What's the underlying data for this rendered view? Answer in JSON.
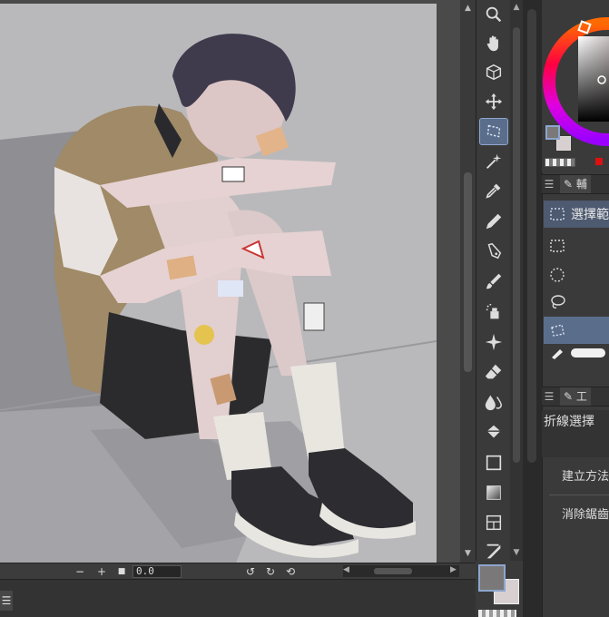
{
  "canvas": {
    "zoom_value": "0.0"
  },
  "status_bar": {
    "zoom_out_label": "−",
    "zoom_in_label": "+",
    "fit_label": "■",
    "menu_label": "☰"
  },
  "tools": [
    {
      "name": "zoom-tool",
      "icon": "magnifier-icon"
    },
    {
      "name": "hand-tool",
      "icon": "hand-icon"
    },
    {
      "name": "object-tool",
      "icon": "object-icon"
    },
    {
      "name": "move-tool",
      "icon": "move-icon"
    },
    {
      "name": "selection-tool",
      "icon": "lasso-selection-icon",
      "active": true
    },
    {
      "name": "auto-select-tool",
      "icon": "magic-wand-icon"
    },
    {
      "name": "eyedropper-tool",
      "icon": "eyedropper-icon"
    },
    {
      "name": "pen-tool",
      "icon": "pen-icon"
    },
    {
      "name": "pencil-tool",
      "icon": "pencil-icon"
    },
    {
      "name": "brush-tool",
      "icon": "brush-icon"
    },
    {
      "name": "airbrush-tool",
      "icon": "airbrush-icon"
    },
    {
      "name": "decoration-tool",
      "icon": "sparkle-icon"
    },
    {
      "name": "eraser-tool",
      "icon": "eraser-icon"
    },
    {
      "name": "blend-tool",
      "icon": "blend-icon"
    },
    {
      "name": "fill-tool",
      "icon": "bucket-icon"
    },
    {
      "name": "figure-tool",
      "icon": "rectangle-icon"
    },
    {
      "name": "gradient-tool",
      "icon": "gradient-icon"
    },
    {
      "name": "frame-tool",
      "icon": "frame-icon"
    },
    {
      "name": "ruler-tool",
      "icon": "ruler-icon"
    }
  ],
  "colors": {
    "main": "#7a7878",
    "sub": "#d8d0d0",
    "accent": "#5a6e8c"
  },
  "sub_tool_panel": {
    "tab_label": "輔",
    "list": [
      {
        "label": "選擇範",
        "selected": false,
        "header": true
      },
      {
        "label": "",
        "icon": "rect-selection-icon"
      },
      {
        "label": "",
        "icon": "ellipse-selection-icon"
      },
      {
        "label": "",
        "icon": "lasso-icon"
      },
      {
        "label": "",
        "icon": "polyline-selection-icon",
        "selected": true
      }
    ]
  },
  "tool_property_panel": {
    "tab_label": "工",
    "tool_name": "折線選擇",
    "props": [
      {
        "label": "建立方法"
      },
      {
        "label": "消除鋸齒"
      }
    ]
  }
}
